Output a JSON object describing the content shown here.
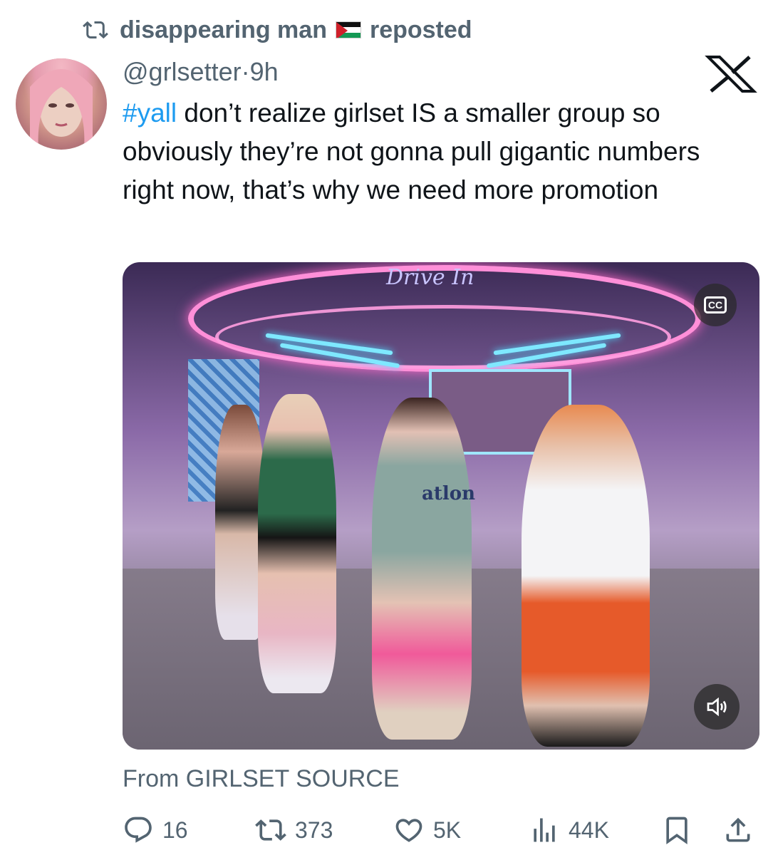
{
  "repost": {
    "user": "disappearing man",
    "label": "reposted",
    "flag": "palestine-flag"
  },
  "tweet": {
    "handle": "@grlsetter",
    "separator": "·",
    "time": "9h",
    "hashtag": "#yall",
    "text": " don’t realize girlset IS a smaller group so obviously they’re not gonna pull gigantic numbers right now, that’s why we need more promotion",
    "media": {
      "sign_text": "Drive In",
      "shirt_text": "atlon",
      "cc_label": "CC"
    },
    "source": "From GIRLSET SOURCE"
  },
  "actions": {
    "replies": "16",
    "reposts": "373",
    "likes": "5K",
    "views": "44K"
  },
  "colors": {
    "accent": "#1d9bf0",
    "muted": "#536471",
    "text": "#0f1419"
  }
}
